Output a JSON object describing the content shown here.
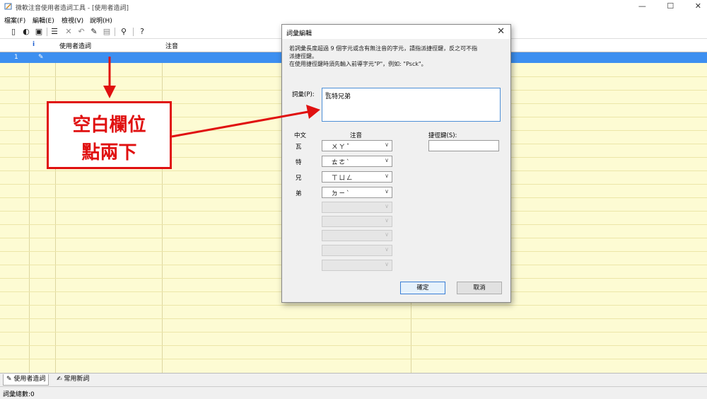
{
  "window": {
    "title": "微軟注音使用者造詞工具 - [使用者造詞]"
  },
  "menu": [
    "檔案(F)",
    "編輯(E)",
    "檢視(V)",
    "說明(H)"
  ],
  "grid": {
    "columns": [
      "使用者造詞",
      "注音"
    ],
    "info_icon": "i",
    "rows": [
      {
        "index": "1"
      }
    ]
  },
  "tabs": [
    "使用者造詞",
    "常用新詞"
  ],
  "status": "詞彙總數:0",
  "dialog": {
    "title": "詞彙編輯",
    "note_line1": "若詞彙長度超過 9 個字元或含有無注音的字元，請指派捷徑鍵，反之可不指",
    "note_line2": "派捷徑鍵。",
    "note_line3": "在使用捷徑鍵時須先輸入前導字元\"P\"，例如: \"Psck\"。",
    "vocab_label": "詞彙(P):",
    "vocab_value": "瓦特兄弟",
    "col_char": "中文",
    "col_zhuyin": "注音",
    "hotkey_label": "捷徑鍵(S):",
    "hotkey_value": "",
    "rows": [
      {
        "char": "瓦",
        "zhuyin": "ㄨㄚˇ"
      },
      {
        "char": "特",
        "zhuyin": "ㄊㄜˋ"
      },
      {
        "char": "兄",
        "zhuyin": "ㄒㄩㄥ"
      },
      {
        "char": "弟",
        "zhuyin": "ㄉㄧˋ"
      }
    ],
    "ok_label": "確定",
    "cancel_label": "取消"
  },
  "annotation": {
    "line1": "空白欄位",
    "line2": "點兩下",
    "color": "#e01010"
  }
}
